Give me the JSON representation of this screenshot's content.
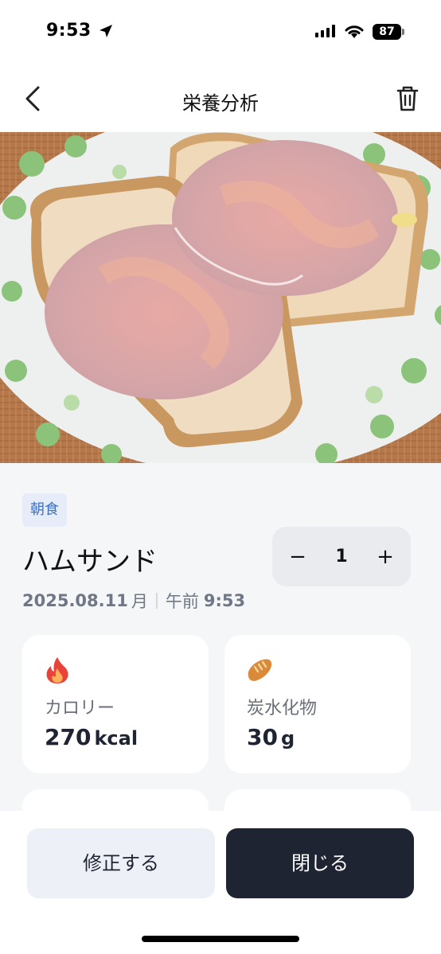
{
  "status_bar": {
    "time": "9:53",
    "battery": "87"
  },
  "nav": {
    "title": "栄養分析",
    "back_icon": "chevron-left-icon",
    "trash_icon": "trash-icon"
  },
  "photo": {
    "icon": "ham-sandwich-photo"
  },
  "food": {
    "meal_type": "朝食",
    "name": "ハムサンド",
    "quantity": "1",
    "minus_label": "−",
    "plus_label": "+",
    "date": "2025.08.11",
    "weekday": "月",
    "ampm": "午前",
    "time": "9:53"
  },
  "nutrients": [
    {
      "icon": "fire-icon",
      "label": "カロリー",
      "value": "270",
      "unit": "kcal"
    },
    {
      "icon": "bread-icon",
      "label": "炭水化物",
      "value": "30",
      "unit": "g"
    }
  ],
  "actions": {
    "edit_label": "修正する",
    "close_label": "閉じる"
  },
  "colors": {
    "primary_dark": "#1f2433",
    "badge_bg": "#e6edf8",
    "badge_text": "#3f6fc4",
    "background": "#f5f6f8"
  }
}
